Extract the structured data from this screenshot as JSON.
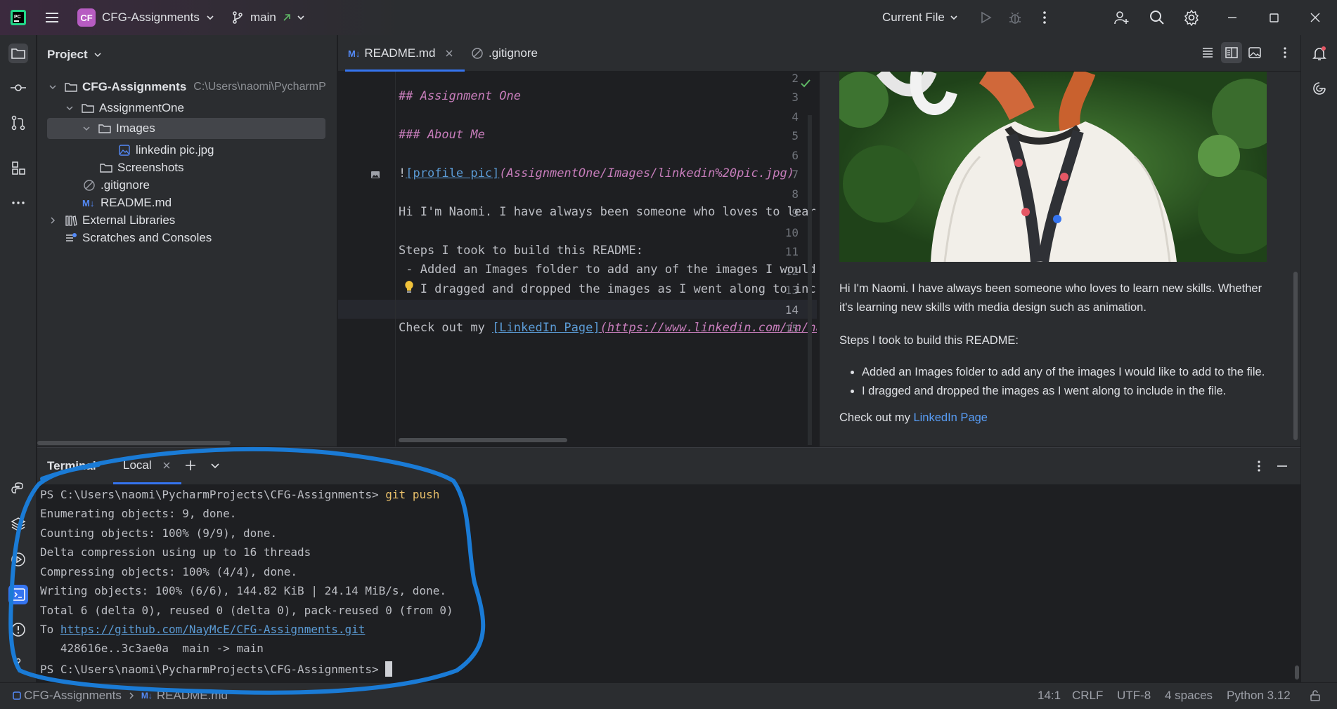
{
  "titlebar": {
    "project_badge": "CF",
    "project_name": "CFG-Assignments",
    "branch": "main",
    "run_config": "Current File"
  },
  "project_panel": {
    "title": "Project",
    "tree": [
      {
        "label": "CFG-Assignments",
        "path": "C:\\Users\\naomi\\PycharmP"
      },
      {
        "label": "AssignmentOne"
      },
      {
        "label": "Images"
      },
      {
        "label": "linkedin pic.jpg"
      },
      {
        "label": "Screenshots"
      },
      {
        "label": ".gitignore"
      },
      {
        "label": "README.md"
      },
      {
        "label": "External Libraries"
      },
      {
        "label": "Scratches and Consoles"
      }
    ]
  },
  "editor": {
    "tabs": [
      {
        "label": "README.md",
        "icon": "markdown-icon"
      },
      {
        "label": ".gitignore",
        "icon": "ignore-icon"
      }
    ],
    "md_badge": "M↓",
    "line_numbers": [
      "2",
      "3",
      "4",
      "5",
      "6",
      "7",
      "8",
      "9",
      "10",
      "11",
      "12",
      "13",
      "14",
      "15"
    ],
    "code": {
      "l3": "## Assignment One",
      "l5": "### About Me",
      "l7_bang": "!",
      "l7_alt": "[profile pic]",
      "l7_url": "(AssignmentOne/Images/linkedin%20pic.jpg)",
      "l9": "Hi I'm Naomi. I have always been someone who loves to learn new skills.",
      "l11": "Steps I took to build this README:",
      "l12": " - Added an Images folder to add any of the images I would like to add to the file.",
      "l13": " - I dragged and dropped the images as I went along to include in the file.",
      "l15_pre": "Check out my ",
      "l15_link": "[LinkedIn Page]",
      "l15_url": "(https://www.linkedin.com/in/naomi)"
    }
  },
  "preview": {
    "para1": "Hi I'm Naomi. I have always been someone who loves to learn new skills. Whether it's learning new skills with media design such as animation.",
    "para2": "Steps I took to build this README:",
    "bullets": [
      "Added an Images folder to add any of the images I would like to add to the file.",
      "I dragged and dropped the images as I went along to include in the file."
    ],
    "para3_pre": "Check out my ",
    "para3_link": "LinkedIn Page"
  },
  "terminal": {
    "title": "Terminal",
    "tab": "Local",
    "lines": {
      "prompt1": "PS C:\\Users\\naomi\\PycharmProjects\\CFG-Assignments> ",
      "cmd": "git push",
      "l2": "Enumerating objects: 9, done.",
      "l3": "Counting objects: 100% (9/9), done.",
      "l4": "Delta compression using up to 16 threads",
      "l5": "Compressing objects: 100% (4/4), done.",
      "l6": "Writing objects: 100% (6/6), 144.82 KiB | 24.14 MiB/s, done.",
      "l7": "Total 6 (delta 0), reused 0 (delta 0), pack-reused 0 (from 0)",
      "l8_pre": "To ",
      "l8_url": "https://github.com/NayMcE/CFG-Assignments.git",
      "l9": "   428616e..3c3ae0a  main -> main",
      "prompt2": "PS C:\\Users\\naomi\\PycharmProjects\\CFG-Assignments> "
    }
  },
  "statusbar": {
    "breadcrumb_project": "CFG-Assignments",
    "breadcrumb_file": "README.md",
    "position": "14:1",
    "line_sep": "CRLF",
    "encoding": "UTF-8",
    "indent": "4 spaces",
    "interpreter": "Python 3.12"
  },
  "colors": {
    "accent": "#3574f0",
    "annotation": "#1a7bd6",
    "heading": "#c77dbb",
    "link": "#589df6"
  }
}
